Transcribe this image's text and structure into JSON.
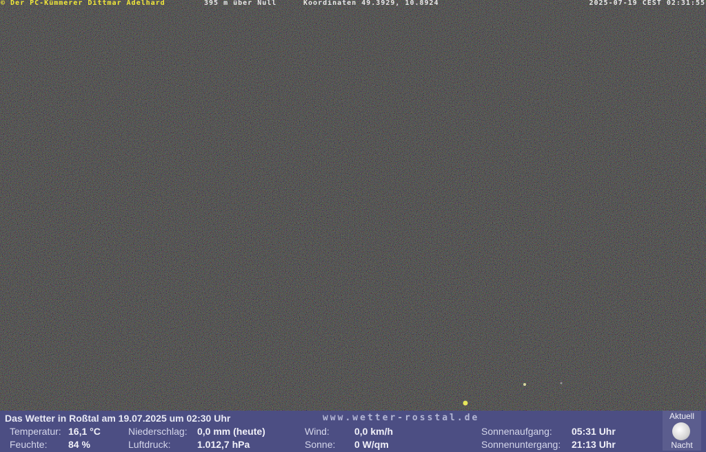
{
  "overlay": {
    "title": "© Der PC-Kümmerer Dittmar Adelhard",
    "altitude": "395 m über Null",
    "coordinates": "Koordinaten 49.3929, 10.8924",
    "timestamp": "2025-07-19 CEST 02:31:55"
  },
  "colors": {
    "bar_background": "#4c4e83",
    "overlay_title": "#f2e93a",
    "overlay_text": "#e8e8e8"
  },
  "weather": {
    "heading": "Das Wetter in Roßtal am 19.07.2025 um 02:30 Uhr",
    "url": "www.wetter-rosstal.de",
    "temp_label": "Temperatur:",
    "temp_value": "16,1 °C",
    "humidity_label": "Feuchte:",
    "humidity_value": "84 %",
    "precip_label": "Niederschlag:",
    "precip_value": "0,0 mm (heute)",
    "pressure_label": "Luftdruck:",
    "pressure_value": "1.012,7 hPa",
    "wind_label": "Wind:",
    "wind_value": "0,0 km/h",
    "sun_label": "Sonne:",
    "sun_value": "0 W/qm",
    "sunrise_label": "Sonnenaufgang:",
    "sunrise_value": "05:31 Uhr",
    "sunset_label": "Sonnenuntergang:",
    "sunset_value": "21:13 Uhr",
    "moon_top": "Aktuell",
    "moon_bottom": "Nacht",
    "moon_icon": "full-moon-icon"
  }
}
